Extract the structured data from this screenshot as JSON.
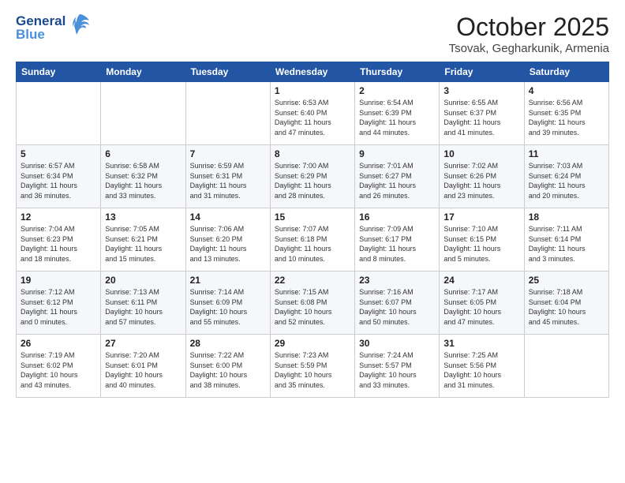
{
  "header": {
    "logo_line1": "General",
    "logo_line2": "Blue",
    "month": "October 2025",
    "location": "Tsovak, Gegharkunik, Armenia"
  },
  "weekdays": [
    "Sunday",
    "Monday",
    "Tuesday",
    "Wednesday",
    "Thursday",
    "Friday",
    "Saturday"
  ],
  "weeks": [
    [
      {
        "day": "",
        "info": ""
      },
      {
        "day": "",
        "info": ""
      },
      {
        "day": "",
        "info": ""
      },
      {
        "day": "1",
        "info": "Sunrise: 6:53 AM\nSunset: 6:40 PM\nDaylight: 11 hours\nand 47 minutes."
      },
      {
        "day": "2",
        "info": "Sunrise: 6:54 AM\nSunset: 6:39 PM\nDaylight: 11 hours\nand 44 minutes."
      },
      {
        "day": "3",
        "info": "Sunrise: 6:55 AM\nSunset: 6:37 PM\nDaylight: 11 hours\nand 41 minutes."
      },
      {
        "day": "4",
        "info": "Sunrise: 6:56 AM\nSunset: 6:35 PM\nDaylight: 11 hours\nand 39 minutes."
      }
    ],
    [
      {
        "day": "5",
        "info": "Sunrise: 6:57 AM\nSunset: 6:34 PM\nDaylight: 11 hours\nand 36 minutes."
      },
      {
        "day": "6",
        "info": "Sunrise: 6:58 AM\nSunset: 6:32 PM\nDaylight: 11 hours\nand 33 minutes."
      },
      {
        "day": "7",
        "info": "Sunrise: 6:59 AM\nSunset: 6:31 PM\nDaylight: 11 hours\nand 31 minutes."
      },
      {
        "day": "8",
        "info": "Sunrise: 7:00 AM\nSunset: 6:29 PM\nDaylight: 11 hours\nand 28 minutes."
      },
      {
        "day": "9",
        "info": "Sunrise: 7:01 AM\nSunset: 6:27 PM\nDaylight: 11 hours\nand 26 minutes."
      },
      {
        "day": "10",
        "info": "Sunrise: 7:02 AM\nSunset: 6:26 PM\nDaylight: 11 hours\nand 23 minutes."
      },
      {
        "day": "11",
        "info": "Sunrise: 7:03 AM\nSunset: 6:24 PM\nDaylight: 11 hours\nand 20 minutes."
      }
    ],
    [
      {
        "day": "12",
        "info": "Sunrise: 7:04 AM\nSunset: 6:23 PM\nDaylight: 11 hours\nand 18 minutes."
      },
      {
        "day": "13",
        "info": "Sunrise: 7:05 AM\nSunset: 6:21 PM\nDaylight: 11 hours\nand 15 minutes."
      },
      {
        "day": "14",
        "info": "Sunrise: 7:06 AM\nSunset: 6:20 PM\nDaylight: 11 hours\nand 13 minutes."
      },
      {
        "day": "15",
        "info": "Sunrise: 7:07 AM\nSunset: 6:18 PM\nDaylight: 11 hours\nand 10 minutes."
      },
      {
        "day": "16",
        "info": "Sunrise: 7:09 AM\nSunset: 6:17 PM\nDaylight: 11 hours\nand 8 minutes."
      },
      {
        "day": "17",
        "info": "Sunrise: 7:10 AM\nSunset: 6:15 PM\nDaylight: 11 hours\nand 5 minutes."
      },
      {
        "day": "18",
        "info": "Sunrise: 7:11 AM\nSunset: 6:14 PM\nDaylight: 11 hours\nand 3 minutes."
      }
    ],
    [
      {
        "day": "19",
        "info": "Sunrise: 7:12 AM\nSunset: 6:12 PM\nDaylight: 11 hours\nand 0 minutes."
      },
      {
        "day": "20",
        "info": "Sunrise: 7:13 AM\nSunset: 6:11 PM\nDaylight: 10 hours\nand 57 minutes."
      },
      {
        "day": "21",
        "info": "Sunrise: 7:14 AM\nSunset: 6:09 PM\nDaylight: 10 hours\nand 55 minutes."
      },
      {
        "day": "22",
        "info": "Sunrise: 7:15 AM\nSunset: 6:08 PM\nDaylight: 10 hours\nand 52 minutes."
      },
      {
        "day": "23",
        "info": "Sunrise: 7:16 AM\nSunset: 6:07 PM\nDaylight: 10 hours\nand 50 minutes."
      },
      {
        "day": "24",
        "info": "Sunrise: 7:17 AM\nSunset: 6:05 PM\nDaylight: 10 hours\nand 47 minutes."
      },
      {
        "day": "25",
        "info": "Sunrise: 7:18 AM\nSunset: 6:04 PM\nDaylight: 10 hours\nand 45 minutes."
      }
    ],
    [
      {
        "day": "26",
        "info": "Sunrise: 7:19 AM\nSunset: 6:02 PM\nDaylight: 10 hours\nand 43 minutes."
      },
      {
        "day": "27",
        "info": "Sunrise: 7:20 AM\nSunset: 6:01 PM\nDaylight: 10 hours\nand 40 minutes."
      },
      {
        "day": "28",
        "info": "Sunrise: 7:22 AM\nSunset: 6:00 PM\nDaylight: 10 hours\nand 38 minutes."
      },
      {
        "day": "29",
        "info": "Sunrise: 7:23 AM\nSunset: 5:59 PM\nDaylight: 10 hours\nand 35 minutes."
      },
      {
        "day": "30",
        "info": "Sunrise: 7:24 AM\nSunset: 5:57 PM\nDaylight: 10 hours\nand 33 minutes."
      },
      {
        "day": "31",
        "info": "Sunrise: 7:25 AM\nSunset: 5:56 PM\nDaylight: 10 hours\nand 31 minutes."
      },
      {
        "day": "",
        "info": ""
      }
    ]
  ]
}
